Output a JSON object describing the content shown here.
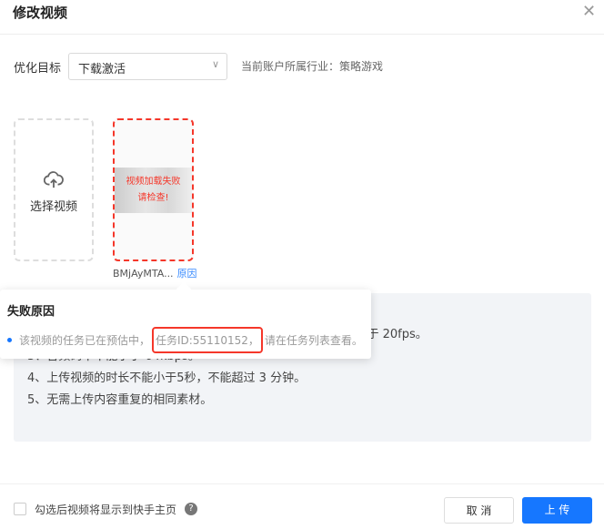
{
  "dialog": {
    "title": "修改视频",
    "close": "✕"
  },
  "form": {
    "goal_label": "优化目标",
    "goal_value": "下载激活",
    "industry": "当前账户所属行业：策略游戏"
  },
  "upload": {
    "label": "选择视频"
  },
  "video": {
    "error_line1": "视频加载失败",
    "error_line2": "请检查!",
    "filename": "BMjAyMTA...",
    "reason_link": "原因"
  },
  "popover": {
    "title": "失败原因",
    "prefix": "该视频的任务已在预估中，",
    "task_id": "任务ID:55110152，",
    "suffix": "请在任务列表查看。"
  },
  "rules": [
    "",
    "2、视频分辨率不小于 720p，码率不小于 1000kbps，帧率不小于 20fps。",
    "3、音频码率不能小于 64kbps。",
    "4、上传视频的时长不能小于5秒，不能超过 3 分钟。",
    "5、无需上传内容重复的相同素材。"
  ],
  "footer": {
    "checkbox_label": "勾选后视频将显示到快手主页",
    "help": "?",
    "cancel": "取 消",
    "upload": "上 传"
  }
}
